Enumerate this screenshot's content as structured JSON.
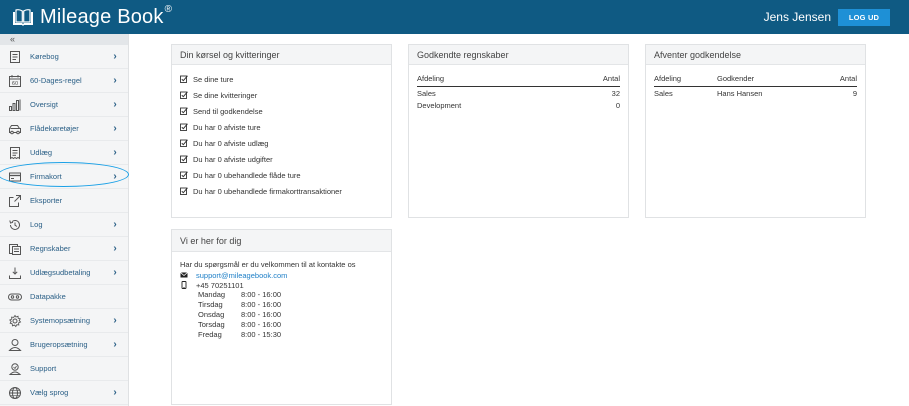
{
  "header": {
    "logo_text": "Mileage Book",
    "logo_reg": "®",
    "user_name": "Jens Jensen",
    "logout_label": "LOG UD"
  },
  "sidebar": {
    "collapse_label": "«",
    "items": [
      {
        "label": "Kørebog",
        "icon": "book-icon",
        "chevron": true
      },
      {
        "label": "60-Dages-regel",
        "icon": "calendar-icon",
        "chevron": true
      },
      {
        "label": "Oversigt",
        "icon": "bar-chart-icon",
        "chevron": true
      },
      {
        "label": "Flådekøretøjer",
        "icon": "car-icon",
        "chevron": true
      },
      {
        "label": "Udlæg",
        "icon": "receipt-icon",
        "chevron": true
      },
      {
        "label": "Firmakort",
        "icon": "credit-card-icon",
        "chevron": true,
        "highlighted": true
      },
      {
        "label": "Eksporter",
        "icon": "export-icon",
        "chevron": false
      },
      {
        "label": "Log",
        "icon": "history-icon",
        "chevron": true
      },
      {
        "label": "Regnskaber",
        "icon": "ledger-icon",
        "chevron": true
      },
      {
        "label": "Udlægsudbetaling",
        "icon": "payout-icon",
        "chevron": true
      },
      {
        "label": "Datapakke",
        "icon": "package-icon",
        "chevron": false
      },
      {
        "label": "Systemopsætning",
        "icon": "gear-icon",
        "chevron": true
      },
      {
        "label": "Brugeropsætning",
        "icon": "user-icon",
        "chevron": true
      },
      {
        "label": "Support",
        "icon": "support-icon",
        "chevron": false
      },
      {
        "label": "Vælg sprog",
        "icon": "globe-icon",
        "chevron": true
      }
    ]
  },
  "trips_card": {
    "title": "Din kørsel og kvitteringer",
    "items": [
      "Se dine ture",
      "Se dine kvitteringer",
      "Send til godkendelse",
      "Du har 0 afviste ture",
      "Du har 0 afviste udlæg",
      "Du har 0 afviste udgifter",
      "Du har 0 ubehandlede flåde ture",
      "Du har 0 ubehandlede firmakorttransaktioner"
    ]
  },
  "approved_card": {
    "title": "Godkendte regnskaber",
    "columns": [
      "Afdeling",
      "Antal"
    ],
    "rows": [
      [
        "Sales",
        "32"
      ],
      [
        "Development",
        "0"
      ]
    ]
  },
  "pending_card": {
    "title": "Afventer godkendelse",
    "columns": [
      "Afdeling",
      "Godkender",
      "Antal"
    ],
    "rows": [
      [
        "Sales",
        "Hans Hansen",
        "9"
      ]
    ]
  },
  "contact_card": {
    "title": "Vi er her for dig",
    "intro": "Har du spørgsmål er du velkommen til at kontakte os",
    "email": "support@mileagebook.com",
    "phone": "+45 70251101",
    "hours": [
      [
        "Mandag",
        "8:00 - 16:00"
      ],
      [
        "Tirsdag",
        "8:00 - 16:00"
      ],
      [
        "Onsdag",
        "8:00 - 16:00"
      ],
      [
        "Torsdag",
        "8:00 - 16:00"
      ],
      [
        "Fredag",
        "8:00 - 15:30"
      ]
    ]
  },
  "colors": {
    "header_bg": "#0f5a83",
    "logout_bg": "#1e90d6",
    "nav_text": "#2a5f86",
    "highlight": "#1aa0e6",
    "link": "#1e7fc7"
  }
}
